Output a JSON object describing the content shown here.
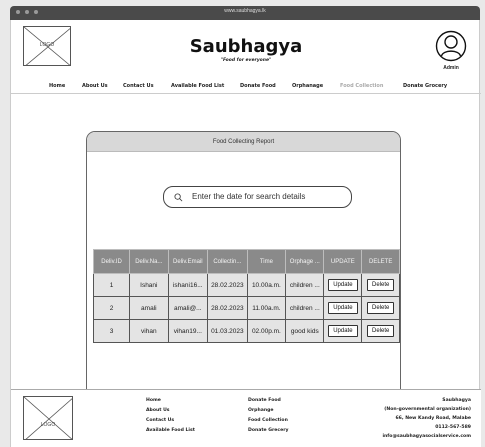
{
  "browser": {
    "url": "www.saubhagya.lk"
  },
  "header": {
    "logo_text": "LOGO",
    "title": "Saubhagya",
    "tagline": "\"Food for everyone\"",
    "admin_label": "Admin"
  },
  "nav": {
    "items": [
      {
        "label": "Home"
      },
      {
        "label": "About Us"
      },
      {
        "label": "Contact Us"
      },
      {
        "label": "Available Food List"
      },
      {
        "label": "Donate Food"
      },
      {
        "label": "Orphanage"
      },
      {
        "label": "Food Collection"
      },
      {
        "label": "Donate Grocery"
      }
    ]
  },
  "report": {
    "title": "Food Collecting Report",
    "search_placeholder": "Enter the date for search details",
    "columns": [
      "Deliv.ID",
      "Deliv.Na...",
      "Deliv.Email",
      "Collectin...",
      "Time",
      "Orphage ...",
      "UPDATE",
      "DELETE"
    ],
    "rows": [
      {
        "id": "1",
        "name": "Ishani",
        "email": "ishani16...",
        "date": "28.02.2023",
        "time": "10.00a.m.",
        "orphanage": "children ...",
        "update": "Update",
        "delete": "Delete"
      },
      {
        "id": "2",
        "name": "amali",
        "email": "amali@...",
        "date": "28.02.2023",
        "time": "11.00a.m.",
        "orphanage": "children ...",
        "update": "Update",
        "delete": "Delete"
      },
      {
        "id": "3",
        "name": "vihan",
        "email": "vihan19...",
        "date": "01.03.2023",
        "time": "02.00p.m.",
        "orphanage": "good kids",
        "update": "Update",
        "delete": "Delete"
      }
    ]
  },
  "footer": {
    "logo_text": "LOGO",
    "links_col1": [
      "Home",
      "About Us",
      "Contact Us",
      "Available Food List"
    ],
    "links_col2": [
      "Donate Food",
      "Orphange",
      "Food Collection",
      "Donate Grecery"
    ],
    "org": [
      "Saubhagya",
      "(Non-governmental organization)",
      "66, New Kandy Road, Malabe",
      "0112-567-589",
      "info@saubhagyasocialservice.com"
    ]
  },
  "colors": {
    "table_header": "#8a8a8a",
    "table_cell": "#e4e4e4",
    "nav_muted": "#aaaaaa"
  }
}
